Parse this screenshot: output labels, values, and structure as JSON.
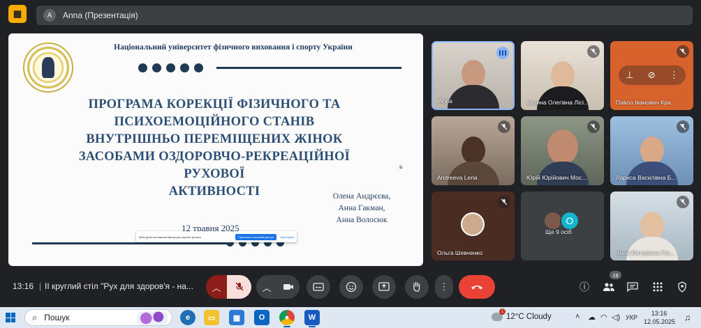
{
  "header": {
    "presenting_avatar": "A",
    "presenting_label": "Anna (Презентація)"
  },
  "slide": {
    "university": "Національний університет фізичного виховання і спорту України",
    "title_lines": [
      "ПРОГРАМА КОРЕКЦІЇ ФІЗИЧНОГО ТА",
      "ПСИХОЕМОЦІЙНОГО СТАНІВ",
      "ВНУТРІШНЬО ПЕРЕМІЩЕНИХ ЖІНОК",
      "ЗАСОБАМИ ОЗДОРОВЧО-РЕКРЕАЦІЙНОЇ РУХОВОЇ",
      "АКТИВНОСТІ"
    ],
    "authors": [
      "Олена Андрєєва,",
      "Анна Гакман,",
      "Анна Волосюк"
    ],
    "date": "12 травня 2025",
    "share_bar": {
      "message": "Meet ділиться вашим вікном для грунтю зустрічі",
      "stop_label": "Припинити спільний доступ",
      "hide_label": "Приховати"
    }
  },
  "participants": [
    {
      "name": "Anna",
      "status": "speaking"
    },
    {
      "name": "Карина Олегівна Лісі...",
      "status": "muted"
    },
    {
      "name": "Павло Іванович Кра...",
      "status": "muted"
    },
    {
      "name": "Andreeva Lena",
      "status": "muted"
    },
    {
      "name": "Юрій Юрійович Мос...",
      "status": "muted"
    },
    {
      "name": "Лариса Василівна Б...",
      "status": "muted"
    },
    {
      "name": "Ольга Шевченко",
      "status": "muted"
    },
    {
      "name": "Ще 9 осіб",
      "status": "",
      "extra_avatar": "O"
    },
    {
      "name": "Анна Вікторівна Гак...",
      "status": "muted"
    }
  ],
  "bottom": {
    "time": "13:16",
    "divider": "|",
    "meeting_title": "II круглий стіл \"Рух для здоров'я - на..."
  },
  "people_count": "18",
  "taskbar": {
    "search_placeholder": "Пошук",
    "weather_badge": "1",
    "weather": "12°C  Cloudy",
    "language": "УКР",
    "clock_time": "13:16",
    "clock_date": "12.05.2025"
  },
  "colors": {
    "meet_bg": "#202124",
    "slide_title": "#2d4f75",
    "end_call": "#ea4335",
    "mic_off": "#f9dedc",
    "speaking": "#8ab4f8"
  }
}
